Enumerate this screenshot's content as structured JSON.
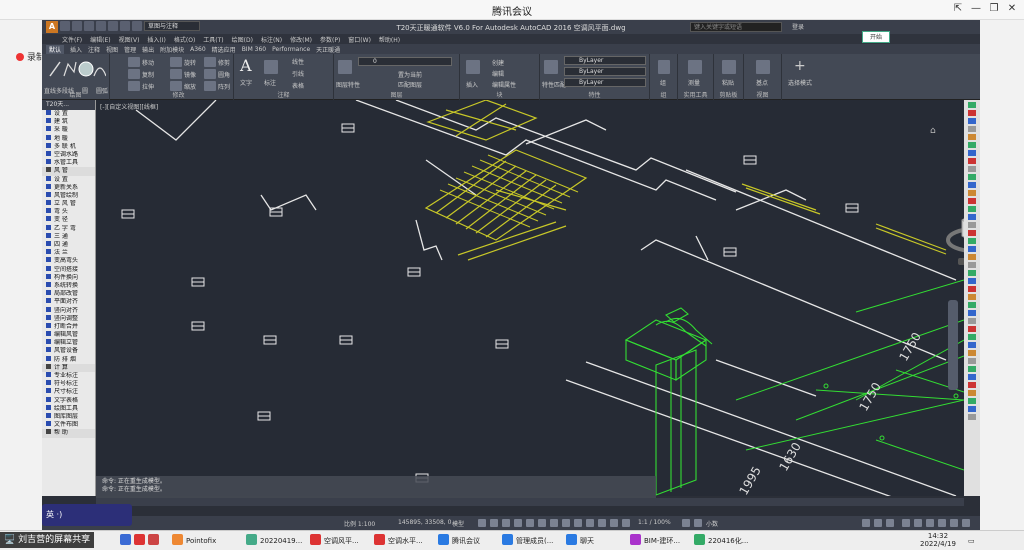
{
  "meeting": {
    "title": "腾讯会议",
    "recording_label": "录制中",
    "share_button": "开始",
    "sharer_label": "刘吉营的屏幕共享"
  },
  "cad": {
    "window_title": "T20天正暖通软件 V6.0 For Autodesk AutoCAD 2016    空调风平面.dwg",
    "workspace": "草图与注释",
    "search_placeholder": "键入关键字或短语",
    "signin": "登录",
    "menus": [
      "文件(F)",
      "编辑(E)",
      "视图(V)",
      "插入(I)",
      "格式(O)",
      "工具(T)",
      "绘图(D)",
      "标注(N)",
      "修改(M)",
      "参数(P)",
      "窗口(W)",
      "帮助(H)"
    ],
    "tabs": [
      "默认",
      "插入",
      "注释",
      "视图",
      "管理",
      "输出",
      "附加模块",
      "A360",
      "精选应用",
      "BIM 360",
      "Performance",
      "天正暖通"
    ],
    "ribbon_groups": [
      "绘图",
      "修改",
      "注释",
      "图层",
      "块",
      "特性",
      "组",
      "实用工具",
      "剪贴板",
      "视图"
    ],
    "ribbon_tools": {
      "draw": [
        "直线",
        "多段线",
        "圆",
        "圆弧"
      ],
      "modify": [
        "移动",
        "旋转",
        "修剪",
        "复制",
        "镜像",
        "圆角",
        "拉伸",
        "缩放",
        "阵列"
      ],
      "annotate": [
        "文字",
        "标注",
        "线性",
        "引线",
        "表格"
      ],
      "layer": [
        "图层特性",
        "置为当前",
        "匹配图层"
      ],
      "block": [
        "插入",
        "创建",
        "编辑",
        "编辑属性"
      ],
      "props": [
        "特性匹配",
        "ByLayer",
        "ByLayer",
        "ByLayer"
      ],
      "group": [
        "组"
      ],
      "util": [
        "测量"
      ],
      "clip": [
        "粘贴"
      ],
      "view": [
        "基点"
      ],
      "select": [
        "选择模式"
      ]
    },
    "layer_value": "0",
    "palette_title": "T20天...",
    "palette_items": [
      {
        "label": "设  置",
        "hdr": false
      },
      {
        "label": "建  筑",
        "hdr": false
      },
      {
        "label": "采  暖",
        "hdr": false
      },
      {
        "label": "地  暖",
        "hdr": false
      },
      {
        "label": "多 联 机",
        "hdr": false
      },
      {
        "label": "空调水路",
        "hdr": false
      },
      {
        "label": "水管工具",
        "hdr": false
      },
      {
        "label": "风  管",
        "hdr": true
      },
      {
        "label": "设  置",
        "hdr": false
      },
      {
        "label": "更新关系",
        "hdr": false
      },
      {
        "label": "风管绘制",
        "hdr": false
      },
      {
        "label": "立 风 管",
        "hdr": false
      },
      {
        "label": "弯  头",
        "hdr": false
      },
      {
        "label": "变  径",
        "hdr": false
      },
      {
        "label": "乙 字 弯",
        "hdr": false
      },
      {
        "label": "三  通",
        "hdr": false
      },
      {
        "label": "四  通",
        "hdr": false
      },
      {
        "label": "法  兰",
        "hdr": false
      },
      {
        "label": "变高弯头",
        "hdr": false
      },
      {
        "label": "空间搭接",
        "hdr": false
      },
      {
        "label": "构件换向",
        "hdr": false
      },
      {
        "label": "系统转换",
        "hdr": false
      },
      {
        "label": "局部改管",
        "hdr": false
      },
      {
        "label": "平面对齐",
        "hdr": false
      },
      {
        "label": "竖向对齐",
        "hdr": false
      },
      {
        "label": "竖向调整",
        "hdr": false
      },
      {
        "label": "打断合并",
        "hdr": false
      },
      {
        "label": "编辑风管",
        "hdr": false
      },
      {
        "label": "编辑立管",
        "hdr": false
      },
      {
        "label": "风管设备",
        "hdr": false
      },
      {
        "label": "防 排 烟",
        "hdr": false
      },
      {
        "label": "计  算",
        "hdr": true
      },
      {
        "label": "专业标注",
        "hdr": false
      },
      {
        "label": "符号标注",
        "hdr": false
      },
      {
        "label": "尺寸标注",
        "hdr": false
      },
      {
        "label": "文字表格",
        "hdr": false
      },
      {
        "label": "绘图工具",
        "hdr": false
      },
      {
        "label": "图库图层",
        "hdr": false
      },
      {
        "label": "文件布图",
        "hdr": false
      },
      {
        "label": "帮  助",
        "hdr": true
      }
    ],
    "view_label": "[-][自定义视图][线框]",
    "command_lines": [
      "命令: 正在重生成模型。",
      "命令: 正在重生成模型。"
    ],
    "dimensions": [
      "1750",
      "1750",
      "1630",
      "1995"
    ],
    "status": {
      "scale": "比例 1:100",
      "coords": "145895, 33508, 0",
      "mode": "模型",
      "annoscale": "1:1 / 100%",
      "units": "小数"
    }
  },
  "ime": {
    "text": "英 ·)"
  },
  "taskbar": {
    "items": [
      "Pointofix",
      "20220419...",
      "空调风平...",
      "空调水平...",
      "腾讯会议",
      "管理成员(...",
      "聊天",
      "BIM-建环...",
      "220416化..."
    ],
    "clock_time": "14:32",
    "clock_date": "2022/4/19"
  },
  "colors": {
    "drawing_bg": "#262b35",
    "wall": "#e6e6e6",
    "green": "#33dd33",
    "yellow": "#c8c828"
  }
}
